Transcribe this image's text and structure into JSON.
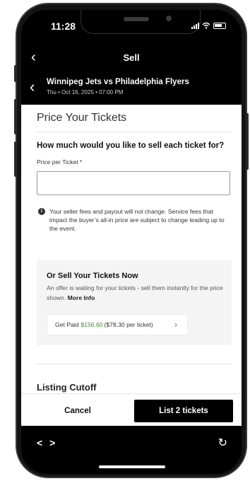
{
  "status_bar": {
    "time": "11:28"
  },
  "header": {
    "back_icon": "‹",
    "title": "Sell"
  },
  "event": {
    "back_icon": "‹",
    "title": "Winnipeg Jets vs Philadelphia Flyers",
    "date": "Thu • Oct 16, 2025 • 07:00 PM"
  },
  "price": {
    "page_title": "Price Your Tickets",
    "question": "How much would you like to sell each ticket for?",
    "field_label": "Price per Ticket *",
    "field_value": "",
    "info_icon": "i",
    "fee_note": "Your seller fees and payout will not change. Service fees that impact the buyer’s all-in price are subject to change leading up to the event."
  },
  "offer": {
    "title": "Or Sell Your Tickets Now",
    "description": "An offer is waiting for your tickets - sell them instantly for the price shown.",
    "more_info": "More Info",
    "get_paid_label": "Get Paid",
    "amount": "$156.60",
    "per_ticket": "($78.30 per ticket)",
    "chevron": "›",
    "amount_color": "#3c8a2e"
  },
  "listing_cutoff": {
    "title": "Listing Cutoff"
  },
  "actions": {
    "cancel": "Cancel",
    "list": "List 2 tickets"
  },
  "browser": {
    "nav_arrows": "< >",
    "refresh_icon": "↻"
  }
}
